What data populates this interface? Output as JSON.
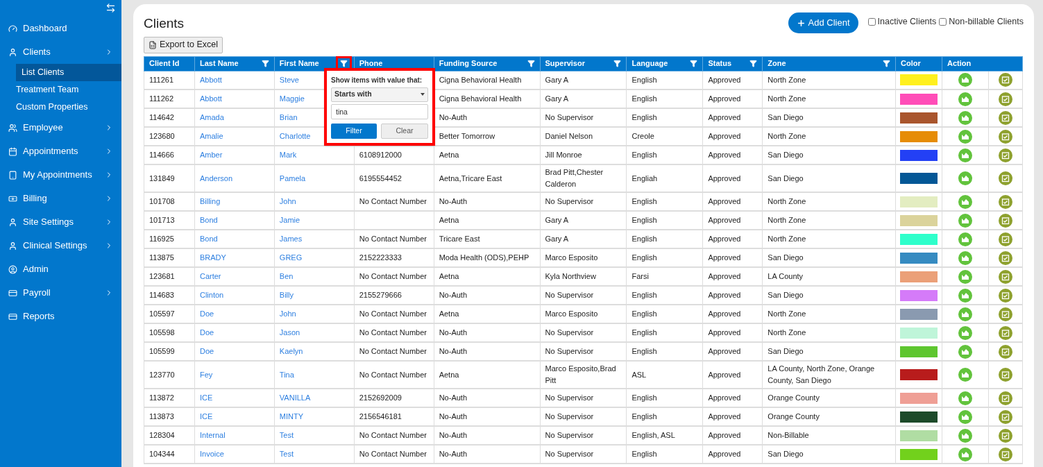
{
  "sidebar": {
    "items": [
      {
        "label": "Dashboard",
        "has_submenu": false
      },
      {
        "label": "Clients",
        "has_submenu": true,
        "expanded": true,
        "children": [
          {
            "label": "List Clients",
            "selected": true
          },
          {
            "label": "Treatment Team",
            "selected": false
          },
          {
            "label": "Custom Properties",
            "selected": false
          }
        ]
      },
      {
        "label": "Employee",
        "has_submenu": true
      },
      {
        "label": "Appointments",
        "has_submenu": true
      },
      {
        "label": "My Appointments",
        "has_submenu": true
      },
      {
        "label": "Billing",
        "has_submenu": true
      },
      {
        "label": "Site Settings",
        "has_submenu": true
      },
      {
        "label": "Clinical Settings",
        "has_submenu": true
      },
      {
        "label": "Admin",
        "has_submenu": false
      },
      {
        "label": "Payroll",
        "has_submenu": true
      },
      {
        "label": "Reports",
        "has_submenu": false
      }
    ]
  },
  "page": {
    "title": "Clients",
    "add_button": "Add Client",
    "export_button": "Export to Excel",
    "checkboxes": [
      {
        "label": "Inactive Clients",
        "checked": false
      },
      {
        "label": "Non-billable Clients",
        "checked": false
      }
    ]
  },
  "table": {
    "columns": [
      {
        "label": "Client Id",
        "filter": false
      },
      {
        "label": "Last Name",
        "filter": true
      },
      {
        "label": "First Name",
        "filter": true,
        "highlighted": true
      },
      {
        "label": "Phone",
        "filter": false
      },
      {
        "label": "Funding Source",
        "filter": true
      },
      {
        "label": "Supervisor",
        "filter": true
      },
      {
        "label": "Language",
        "filter": true
      },
      {
        "label": "Status",
        "filter": true
      },
      {
        "label": "Zone",
        "filter": true
      },
      {
        "label": "Color",
        "filter": false
      },
      {
        "label": "Action",
        "filter": false
      }
    ],
    "rows": [
      {
        "id": "111261",
        "last": "Abbott",
        "first": "Steve",
        "funding": "Cigna Behavioral Health",
        "supervisor": "Gary A",
        "language": "English",
        "status": "Approved",
        "zone": "North Zone",
        "color": "#fff01e"
      },
      {
        "id": "111262",
        "last": "Abbott",
        "first": "Maggie",
        "funding": "Cigna Behavioral Health",
        "supervisor": "Gary A",
        "language": "English",
        "status": "Approved",
        "zone": "North Zone",
        "color": "#ff4db8"
      },
      {
        "id": "114642",
        "last": "Amada",
        "first": "Brian",
        "funding": "No-Auth",
        "supervisor": "No Supervisor",
        "language": "English",
        "status": "Approved",
        "zone": "San Diego",
        "color": "#a9552d"
      },
      {
        "id": "123680",
        "last": "Amalie",
        "first": "Charlotte",
        "funding": "Better Tomorrow",
        "supervisor": "Daniel Nelson",
        "language": "Creole",
        "status": "Approved",
        "zone": "North Zone",
        "color": "#e68c07"
      },
      {
        "id": "114666",
        "last": "Amber",
        "first": "Mark",
        "phone": "6108912000",
        "funding": "Aetna",
        "supervisor": "Jill Monroe",
        "language": "English",
        "status": "Approved",
        "zone": "San Diego",
        "color": "#2340f5"
      },
      {
        "id": "131849",
        "last": "Anderson",
        "first": "Pamela",
        "phone": "6195554452",
        "funding": "Aetna,Tricare East",
        "supervisor": "Brad Pitt,Chester Calderon",
        "language": "Engliah",
        "status": "Approved",
        "zone": "San Diego",
        "color": "#045796"
      },
      {
        "id": "101708",
        "last": "Billing",
        "first": "John",
        "phone": "No Contact Number",
        "funding": "No-Auth",
        "supervisor": "No Supervisor",
        "language": "English",
        "status": "Approved",
        "zone": "North Zone",
        "color": "#e3edc1"
      },
      {
        "id": "101713",
        "last": "Bond",
        "first": "Jamie",
        "funding": "Aetna",
        "supervisor": "Gary A",
        "language": "English",
        "status": "Approved",
        "zone": "North Zone",
        "color": "#dbd39b"
      },
      {
        "id": "116925",
        "last": "Bond",
        "first": "James",
        "phone": "No Contact Number",
        "funding": "Tricare East",
        "supervisor": "Gary A",
        "language": "English",
        "status": "Approved",
        "zone": "North Zone",
        "color": "#2effcb"
      },
      {
        "id": "113875",
        "last": "BRADY",
        "first": "GREG",
        "phone": "2152223333",
        "funding": "Moda Health (ODS),PEHP",
        "supervisor": "Marco Esposito",
        "language": "English",
        "status": "Approved",
        "zone": "San Diego",
        "color": "#368bc1"
      },
      {
        "id": "123681",
        "last": "Carter",
        "first": "Ben",
        "phone": "No Contact Number",
        "funding": "Aetna",
        "supervisor": "Kyla Northview",
        "language": "Farsi",
        "status": "Approved",
        "zone": "LA County",
        "color": "#eba078"
      },
      {
        "id": "114683",
        "last": "Clinton",
        "first": "Billy",
        "phone": "2155279666",
        "funding": "No-Auth",
        "supervisor": "No Supervisor",
        "language": "English",
        "status": "Approved",
        "zone": "San Diego",
        "color": "#d57bf9"
      },
      {
        "id": "105597",
        "last": "Doe",
        "first": "John",
        "phone": "No Contact Number",
        "funding": "Aetna",
        "supervisor": "Marco Esposito",
        "language": "English",
        "status": "Approved",
        "zone": "North Zone",
        "color": "#8a9ab0"
      },
      {
        "id": "105598",
        "last": "Doe",
        "first": "Jason",
        "phone": "No Contact Number",
        "funding": "No-Auth",
        "supervisor": "No Supervisor",
        "language": "English",
        "status": "Approved",
        "zone": "North Zone",
        "color": "#bff5d9"
      },
      {
        "id": "105599",
        "last": "Doe",
        "first": "Kaelyn",
        "phone": "No Contact Number",
        "funding": "No-Auth",
        "supervisor": "No Supervisor",
        "language": "English",
        "status": "Approved",
        "zone": "San Diego",
        "color": "#5ec62f"
      },
      {
        "id": "123770",
        "last": "Fey",
        "first": "Tina",
        "phone": "No Contact Number",
        "funding": "Aetna",
        "supervisor": "Marco Esposito,Brad Pitt",
        "language": "ASL",
        "status": "Approved",
        "zone": "LA County, North Zone, Orange County, San Diego",
        "color": "#b81c1c"
      },
      {
        "id": "113872",
        "last": "ICE",
        "first": "VANILLA",
        "phone": "2152692009",
        "funding": "No-Auth",
        "supervisor": "No Supervisor",
        "language": "English",
        "status": "Approved",
        "zone": "Orange County",
        "color": "#ef9f95"
      },
      {
        "id": "113873",
        "last": "ICE",
        "first": "MINTY",
        "phone": "2156546181",
        "funding": "No-Auth",
        "supervisor": "No Supervisor",
        "language": "English",
        "status": "Approved",
        "zone": "Orange County",
        "color": "#1d4a2a"
      },
      {
        "id": "128304",
        "last": "Internal",
        "first": "Test",
        "phone": "No Contact Number",
        "funding": "No-Auth",
        "supervisor": "No Supervisor",
        "language": "English, ASL",
        "status": "Approved",
        "zone": "Non-Billable",
        "color": "#b0dda3"
      },
      {
        "id": "104344",
        "last": "Invoice",
        "first": "Test",
        "phone": "No Contact Number",
        "funding": "No-Auth",
        "supervisor": "No Supervisor",
        "language": "English",
        "status": "Approved",
        "zone": "San Diego",
        "color": "#72d11c"
      }
    ]
  },
  "filter_popup": {
    "prompt": "Show items with value that:",
    "operator": "Starts with",
    "value": "tina",
    "filter_button": "Filter",
    "clear_button": "Clear"
  }
}
